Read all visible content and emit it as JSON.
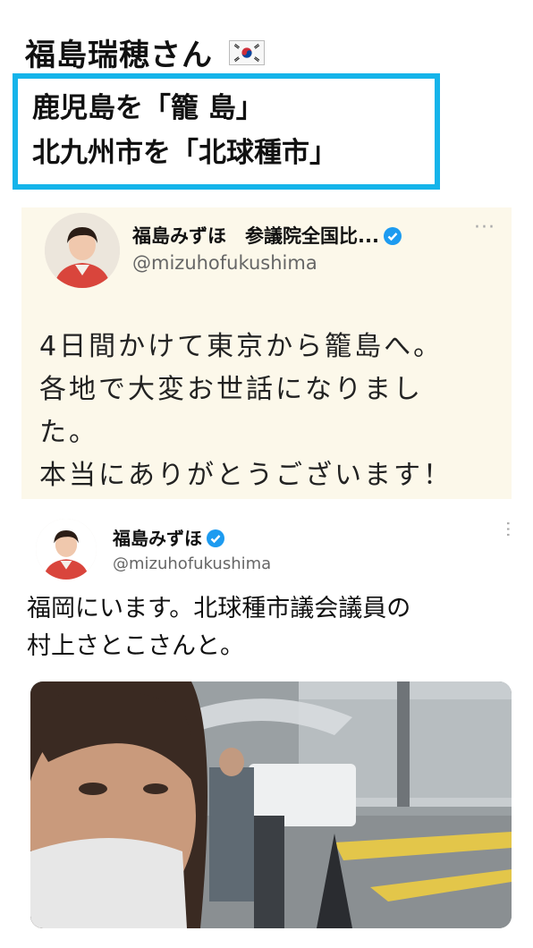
{
  "header": {
    "title": "福島瑞穂さん",
    "flag_icon": "south-korea-flag-icon"
  },
  "highlight": {
    "line1": "鹿児島を「籠 島」",
    "line2": "北九州市を「北球種市」",
    "border_color": "#15b4ea"
  },
  "tweet1": {
    "display_name": "福島みずほ　参議院全国比...",
    "handle": "@mizuhofukushima",
    "more_label": "···",
    "body_lines": [
      "4日間かけて東京から籠島へ。",
      "各地で大変お世話になりまし",
      "た。",
      "本当にありがとうございます！"
    ],
    "background": "#fcf8ea"
  },
  "tweet2": {
    "display_name": "福島みずほ",
    "handle": "@mizuhofukushima",
    "more_label": "···",
    "body_lines": [
      "福岡にいます。北球種市議会議員の",
      "村上さとこさんと。"
    ]
  },
  "colors": {
    "verified_blue": "#1d9bf0",
    "handle_gray": "#666666"
  }
}
